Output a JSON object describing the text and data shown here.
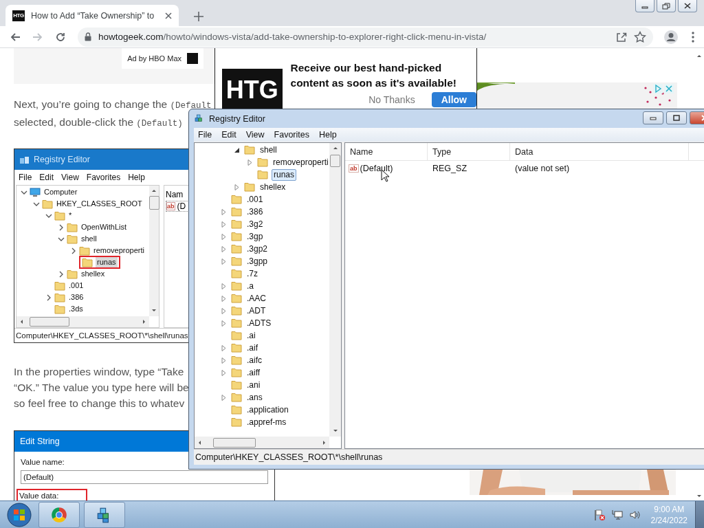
{
  "browser": {
    "tab": {
      "favicon_text": "HTG",
      "title": "How to Add “Take Ownership” to",
      "selected": true
    },
    "nav_buttons": [
      {
        "kind": "back",
        "disabled": false
      },
      {
        "kind": "forward",
        "disabled": true
      },
      {
        "kind": "reload",
        "disabled": false
      }
    ],
    "url": {
      "host": "howtogeek.com",
      "path": "/howto/windows-vista/add-take-ownership-to-explorer-right-click-menu-in-vista/"
    }
  },
  "page": {
    "ad_label": "Ad by HBO Max",
    "paragraph_1": [
      {
        "text": "Next, you’re going to change the",
        "code": "(Default"
      },
      {
        "text": "selected, double-click the",
        "code": "(Default)"
      }
    ],
    "screenshot_1": {
      "title": "Registry Editor",
      "menu": [
        "File",
        "Edit",
        "View",
        "Favorites",
        "Help"
      ],
      "tree": [
        {
          "label": "Computer",
          "kind": "computer",
          "has_children": true,
          "expanded": true,
          "selected": false,
          "annotated": false,
          "children": [
            {
              "label": "HKEY_CLASSES_ROOT",
              "has_children": true,
              "expanded": true,
              "selected": false,
              "annotated": false,
              "children": [
                {
                  "label": "*",
                  "has_children": true,
                  "expanded": true,
                  "selected": false,
                  "annotated": false,
                  "children": [
                    {
                      "label": "OpenWithList",
                      "has_children": true,
                      "expanded": false,
                      "selected": false,
                      "annotated": false
                    },
                    {
                      "label": "shell",
                      "has_children": true,
                      "expanded": true,
                      "selected": false,
                      "annotated": false,
                      "children": [
                        {
                          "label": "removeproperti",
                          "has_children": true,
                          "expanded": false,
                          "selected": false,
                          "annotated": false
                        },
                        {
                          "label": "runas",
                          "has_children": false,
                          "selected": true,
                          "annotated": true
                        }
                      ]
                    },
                    {
                      "label": "shellex",
                      "has_children": true,
                      "expanded": false,
                      "selected": false,
                      "annotated": false
                    }
                  ]
                },
                {
                  "label": ".001",
                  "has_children": false,
                  "selected": false,
                  "annotated": false
                },
                {
                  "label": ".386",
                  "has_children": true,
                  "expanded": false,
                  "selected": false,
                  "annotated": false
                },
                {
                  "label": ".3ds",
                  "has_children": false,
                  "selected": false,
                  "annotated": false
                }
              ]
            }
          ]
        }
      ],
      "name_header": "Nam",
      "value_icon_text": "ab",
      "value_name": "(D",
      "status": "Computer\\HKEY_CLASSES_ROOT\\*\\shell\\runas"
    },
    "paragraph_2": [
      {
        "text": "In the properties window, type “Take"
      },
      {
        "text": "“OK.” The value you type here will be"
      },
      {
        "text": "so feel free to change this to whatev"
      }
    ],
    "screenshot_2": {
      "title": "Edit String",
      "value_name_label": "Value name:",
      "value_name": "(Default)",
      "value_data_label": "Value data:",
      "value_data_annotated": true
    }
  },
  "popup": {
    "logo_text": "HTG",
    "message": "Receive our best hand-picked content as soon as it's available!",
    "buttons": [
      {
        "kind": "secondary",
        "label": "No Thanks"
      },
      {
        "kind": "primary",
        "label": "Allow"
      }
    ]
  },
  "registry_editor": {
    "title": "Registry Editor",
    "menu": [
      "File",
      "Edit",
      "View",
      "Favorites",
      "Help"
    ],
    "tree": [
      {
        "children": [
          {
            "label": "shell",
            "has_children": true,
            "expanded": true,
            "selected": false,
            "children": [
              {
                "label": "removeproperti",
                "has_children": true,
                "expanded": false,
                "selected": false
              },
              {
                "label": "runas",
                "has_children": false,
                "selected": true
              }
            ]
          },
          {
            "label": "shellex",
            "has_children": true,
            "expanded": false,
            "selected": false
          }
        ]
      },
      {
        "label": ".001",
        "has_children": false,
        "selected": false
      },
      {
        "label": ".386",
        "has_children": true,
        "expanded": false,
        "selected": false
      },
      {
        "label": ".3g2",
        "has_children": true,
        "expanded": false,
        "selected": false
      },
      {
        "label": ".3gp",
        "has_children": true,
        "expanded": false,
        "selected": false
      },
      {
        "label": ".3gp2",
        "has_children": true,
        "expanded": false,
        "selected": false
      },
      {
        "label": ".3gpp",
        "has_children": true,
        "expanded": false,
        "selected": false
      },
      {
        "label": ".7z",
        "has_children": false,
        "selected": false
      },
      {
        "label": ".a",
        "has_children": true,
        "expanded": false,
        "selected": false
      },
      {
        "label": ".AAC",
        "has_children": true,
        "expanded": false,
        "selected": false
      },
      {
        "label": ".ADT",
        "has_children": true,
        "expanded": false,
        "selected": false
      },
      {
        "label": ".ADTS",
        "has_children": true,
        "expanded": false,
        "selected": false
      },
      {
        "label": ".ai",
        "has_children": false,
        "selected": false
      },
      {
        "label": ".aif",
        "has_children": true,
        "expanded": false,
        "selected": false
      },
      {
        "label": ".aifc",
        "has_children": true,
        "expanded": false,
        "selected": false
      },
      {
        "label": ".aiff",
        "has_children": true,
        "expanded": false,
        "selected": false
      },
      {
        "label": ".ani",
        "has_children": false,
        "selected": false
      },
      {
        "label": ".ans",
        "has_children": true,
        "expanded": false,
        "selected": false
      },
      {
        "label": ".application",
        "has_children": false,
        "selected": false
      },
      {
        "label": ".appref-ms",
        "has_children": false,
        "selected": false
      }
    ],
    "columns": [
      "Name",
      "Type",
      "Data"
    ],
    "values": [
      {
        "icon_text": "ab",
        "name": "(Default)",
        "type": "REG_SZ",
        "data": "(value not set)"
      }
    ],
    "status": "Computer\\HKEY_CLASSES_ROOT\\*\\shell\\runas"
  },
  "taskbar": {
    "apps": [
      {
        "kind": "browser"
      },
      {
        "kind": "regedit"
      }
    ],
    "time": "9:00 AM",
    "date": "2/24/2022"
  }
}
